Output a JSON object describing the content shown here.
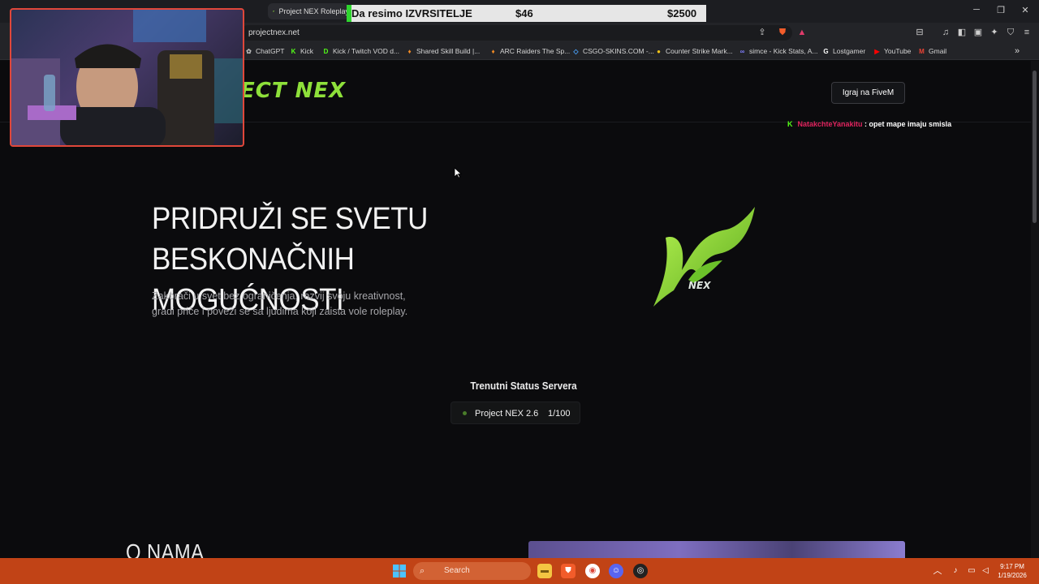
{
  "browser": {
    "tab_title": "Project NEX Roleplay",
    "url": "projectnex.net",
    "bookmarks": [
      {
        "label": "ChatGPT",
        "icon": "chatgpt-icon",
        "color": "#aaaaaa"
      },
      {
        "label": "Kick",
        "icon": "kick-icon",
        "color": "#53fc18"
      },
      {
        "label": "Kick / Twitch VOD d...",
        "icon": "kick-d-icon",
        "color": "#53fc18"
      },
      {
        "label": "Shared Skill Build |...",
        "icon": "arc-icon",
        "color": "#f08a24"
      },
      {
        "label": "ARC Raiders The Sp...",
        "icon": "arc-icon",
        "color": "#f08a24"
      },
      {
        "label": "CSGO-SKINS.COM -...",
        "icon": "gem-icon",
        "color": "#4aa3ff"
      },
      {
        "label": "Counter Strike Mark...",
        "icon": "circle-icon",
        "color": "#f5c518"
      },
      {
        "label": "simce - Kick Stats, A...",
        "icon": "stats-icon",
        "color": "#7f7fff"
      },
      {
        "label": "Lostgamer",
        "icon": "lostgamer-icon",
        "color": "#ffffff"
      },
      {
        "label": "YouTube",
        "icon": "youtube-icon",
        "color": "#ff0000"
      },
      {
        "label": "Gmail",
        "icon": "gmail-icon",
        "color": "#ea4335"
      }
    ]
  },
  "overlay": {
    "label": "Da resimo IZVRSITELJE",
    "amount1": "$46",
    "amount2": "$2500"
  },
  "site": {
    "logo_text": "ECT NEX",
    "play_button": "Igraj na FiveM",
    "chat": {
      "user": "NatakchteYanakitu",
      "message": " : opet mape imaju smisla"
    },
    "hero_title_line1": "PRIDRUŽI SE SVETU",
    "hero_title_line2": "BESKONAČNIH MOGUĆNOSTI",
    "hero_sub_line1": "Zakorači u svet bez ograničenja, razvij svoju kreativnost,",
    "hero_sub_line2": "gradi priče i poveži se sa ljudima koji zaista vole roleplay.",
    "hero_logo_caption": "NEX",
    "status_title": "Trenutni Status Servera",
    "server_name": "Project NEX 2.6",
    "server_count": "1/100",
    "section_title": "O NAMA",
    "accent_color": "#8ee03a"
  },
  "taskbar": {
    "search_placeholder": "Search",
    "time": "9:17 PM",
    "date": "1/19/2026"
  }
}
